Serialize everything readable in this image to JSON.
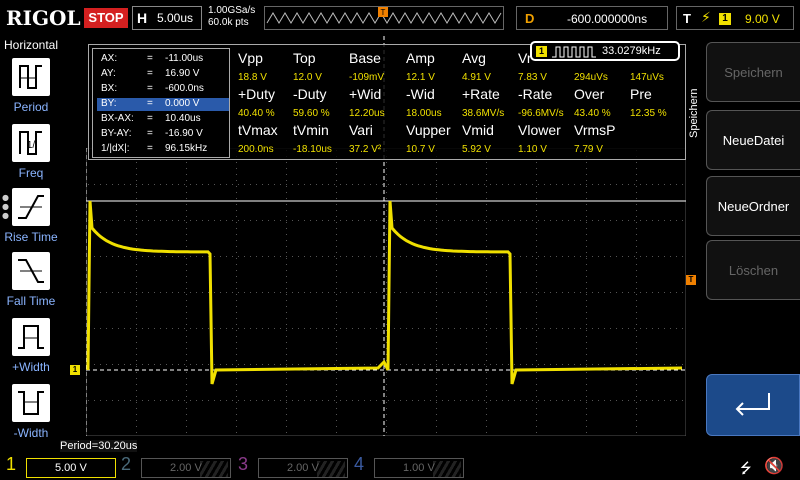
{
  "header": {
    "logo": "RIGOL",
    "run_state": "STOP",
    "horizontal_label": "H",
    "timebase": "5.00us",
    "sample_rate": "1.00GSa/s",
    "memory_depth": "60.0k pts",
    "trigger_marker": "T",
    "delay_label": "D",
    "delay_value": "-600.000000ns",
    "trigger_label": "T",
    "trigger_source": "1",
    "trigger_level": "9.00 V"
  },
  "left_menu": {
    "title": "Horizontal",
    "items": [
      {
        "label": "Period",
        "icon": "period-icon"
      },
      {
        "label": "Freq",
        "icon": "freq-icon"
      },
      {
        "label": "Rise Time",
        "icon": "rise-time-icon"
      },
      {
        "label": "Fall Time",
        "icon": "fall-time-icon"
      },
      {
        "label": "+Width",
        "icon": "pos-width-icon"
      },
      {
        "label": "-Width",
        "icon": "neg-width-icon"
      }
    ]
  },
  "right_menu": {
    "title": "Speichern",
    "buttons": [
      {
        "label": "Speichern",
        "enabled": false
      },
      {
        "label": "NeueDatei",
        "enabled": true
      },
      {
        "label": "NeueOrdner",
        "enabled": true
      },
      {
        "label": "Löschen",
        "enabled": false
      }
    ],
    "back_icon": "enter-return-icon"
  },
  "cursors": [
    {
      "label": "AX:",
      "value": "-11.00us",
      "selected": false
    },
    {
      "label": "AY:",
      "value": "16.90 V",
      "selected": false
    },
    {
      "label": "BX:",
      "value": "-600.0ns",
      "selected": false
    },
    {
      "label": "BY:",
      "value": "0.000 V",
      "selected": true
    },
    {
      "label": "BX-AX:",
      "value": "10.40us",
      "selected": false
    },
    {
      "label": "BY-AY:",
      "value": "-16.90 V",
      "selected": false
    },
    {
      "label": "1/|dX|:",
      "value": "96.15kHz",
      "selected": false
    }
  ],
  "frequency_counter": {
    "channel": "1",
    "value": "33.0279kHz"
  },
  "measurements": {
    "row1_heads": [
      "Vpp",
      "Top",
      "Base",
      "Amp",
      "Avg",
      "Vr"
    ],
    "row1_vals": [
      "18.8 V",
      "12.0 V",
      "-109mV",
      "12.1 V",
      "4.91 V",
      "7.83 V",
      "294uVs",
      "147uVs"
    ],
    "row2_heads": [
      "+Duty",
      "-Duty",
      "+Wid",
      "-Wid",
      "+Rate",
      "-Rate",
      "Over",
      "Pre"
    ],
    "row2_vals": [
      "40.40 %",
      "59.60 %",
      "12.20us",
      "18.00us",
      "38.6MV/s",
      "-96.6MV/s",
      "43.40 %",
      "12.35 %"
    ],
    "row3_heads": [
      "tVmax",
      "tVmin",
      "Vari",
      "Vupper",
      "Vmid",
      "Vlower",
      "VrmsP"
    ],
    "row3_vals": [
      "200.0ns",
      "-18.10us",
      "37.2 V²",
      "10.7 V",
      "5.92 V",
      "1.10 V",
      "7.79 V"
    ]
  },
  "waveform": {
    "color": "#f0e000",
    "cursor_color": "#ffffff",
    "ch1_marker": "1",
    "trig_marker": "T",
    "period_readout": "Period=30.20us"
  },
  "channels": [
    {
      "num": "1",
      "scale": "5.00 V",
      "active": true,
      "color": "#f0e000"
    },
    {
      "num": "2",
      "scale": "2.00 V",
      "active": false,
      "color": "#4a6a7a"
    },
    {
      "num": "3",
      "scale": "2.00 V",
      "active": false,
      "color": "#8a3a8a"
    },
    {
      "num": "4",
      "scale": "1.00 V",
      "active": false,
      "color": "#3a5aa0"
    }
  ],
  "status_icons": [
    "usb-icon",
    "speaker-mute-icon"
  ]
}
